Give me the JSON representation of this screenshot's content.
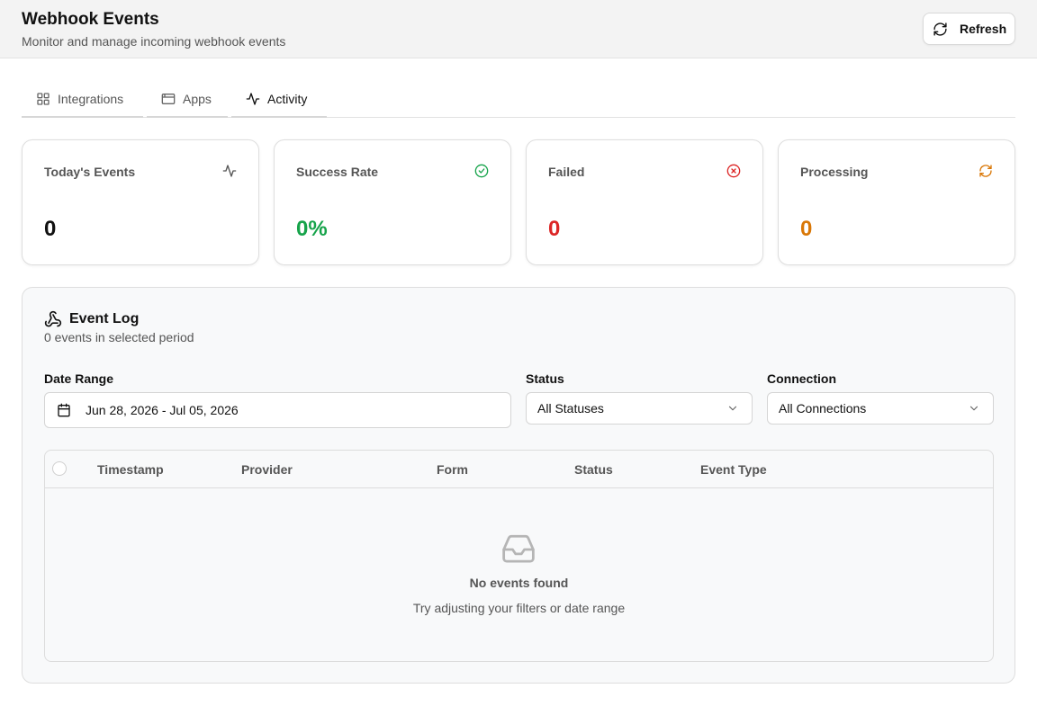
{
  "header": {
    "title": "Webhook Events",
    "subtitle": "Monitor and manage incoming webhook events",
    "refresh_label": "Refresh"
  },
  "tabs": [
    {
      "label": "Integrations",
      "icon": "grid-icon",
      "active": false
    },
    {
      "label": "Apps",
      "icon": "app-window-icon",
      "active": false
    },
    {
      "label": "Activity",
      "icon": "activity-icon",
      "active": true
    }
  ],
  "stats": [
    {
      "label": "Today's Events",
      "value": "0",
      "icon": "activity-icon",
      "color": "#111111"
    },
    {
      "label": "Success Rate",
      "value": "0%",
      "icon": "check-circle-icon",
      "color": "#16a34a"
    },
    {
      "label": "Failed",
      "value": "0",
      "icon": "x-circle-icon",
      "color": "#dc2626"
    },
    {
      "label": "Processing",
      "value": "0",
      "icon": "refresh-icon",
      "color": "#d97706"
    }
  ],
  "event_log": {
    "title": "Event Log",
    "subtitle": "0 events in selected period",
    "filters": {
      "date_range_label": "Date Range",
      "date_range_value": "Jun 28, 2026 - Jul 05, 2026",
      "status_label": "Status",
      "status_value": "All Statuses",
      "connection_label": "Connection",
      "connection_value": "All Connections"
    },
    "table": {
      "columns": [
        "Timestamp",
        "Provider",
        "Form",
        "Status",
        "Event Type"
      ],
      "rows": []
    },
    "empty": {
      "title": "No events found",
      "subtitle": "Try adjusting your filters or date range"
    }
  }
}
